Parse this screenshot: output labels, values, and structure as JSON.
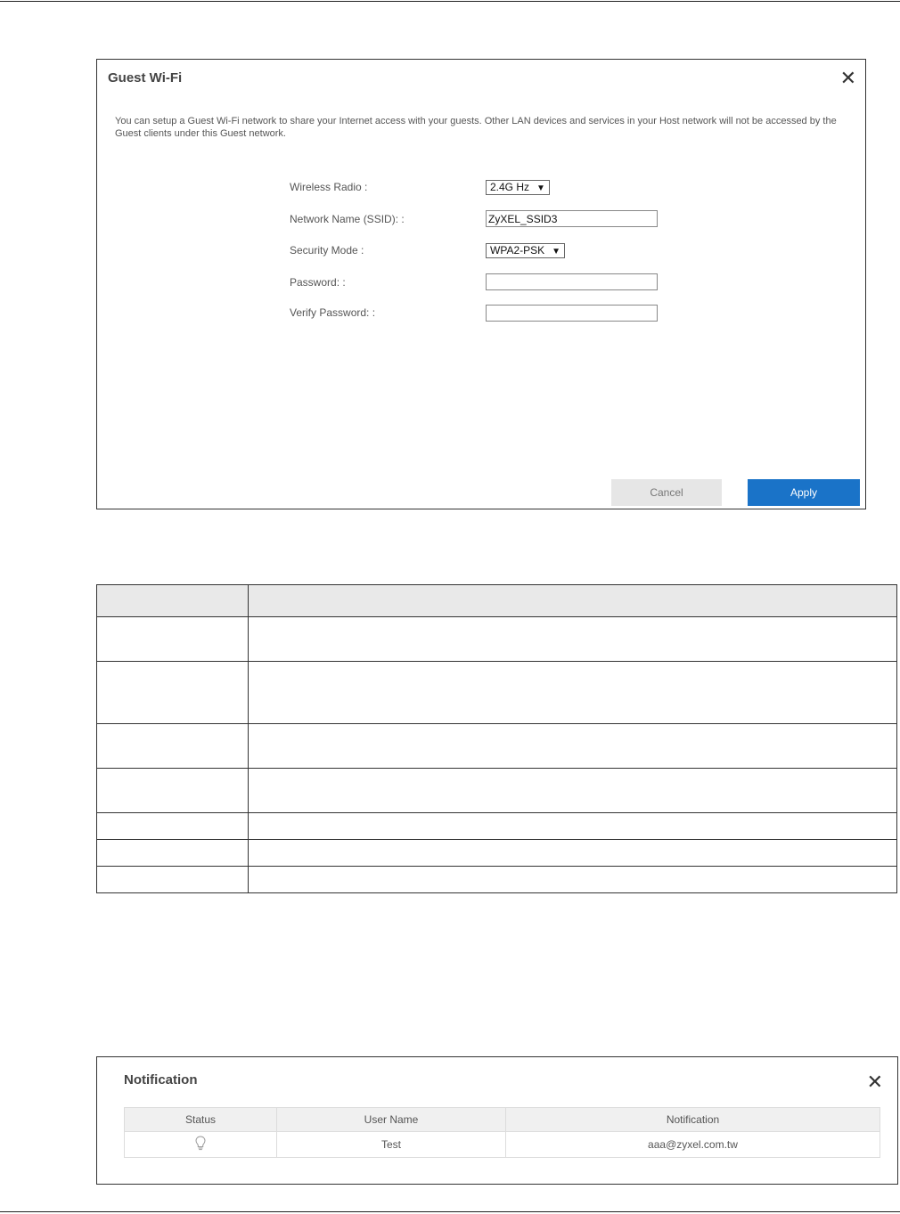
{
  "guest_wifi": {
    "title": "Guest Wi-Fi",
    "description": "You can setup a Guest Wi-Fi network to share your Internet access with your guests. Other LAN devices and services in your Host network will not be accessed by the Guest clients under this Guest network.",
    "wireless_radio": {
      "label": "Wireless Radio :",
      "value": "2.4G Hz"
    },
    "ssid": {
      "label": "Network Name (SSID): :",
      "value": "ZyXEL_SSID3"
    },
    "security_mode": {
      "label": "Security Mode :",
      "value": "WPA2-PSK"
    },
    "password": {
      "label": "Password: :",
      "value": ""
    },
    "verify_password": {
      "label": "Verify Password: :",
      "value": ""
    },
    "cancel_label": "Cancel",
    "apply_label": "Apply"
  },
  "notification": {
    "title": "Notification",
    "columns": [
      "Status",
      "User Name",
      "Notification"
    ],
    "rows": [
      {
        "status_icon": "lightbulb-icon",
        "user_name": "Test",
        "notification": "aaa@zyxel.com.tw"
      }
    ]
  },
  "icons": {
    "close": "close-icon",
    "dropdown": "caret-down-icon",
    "status": "lightbulb-icon"
  }
}
